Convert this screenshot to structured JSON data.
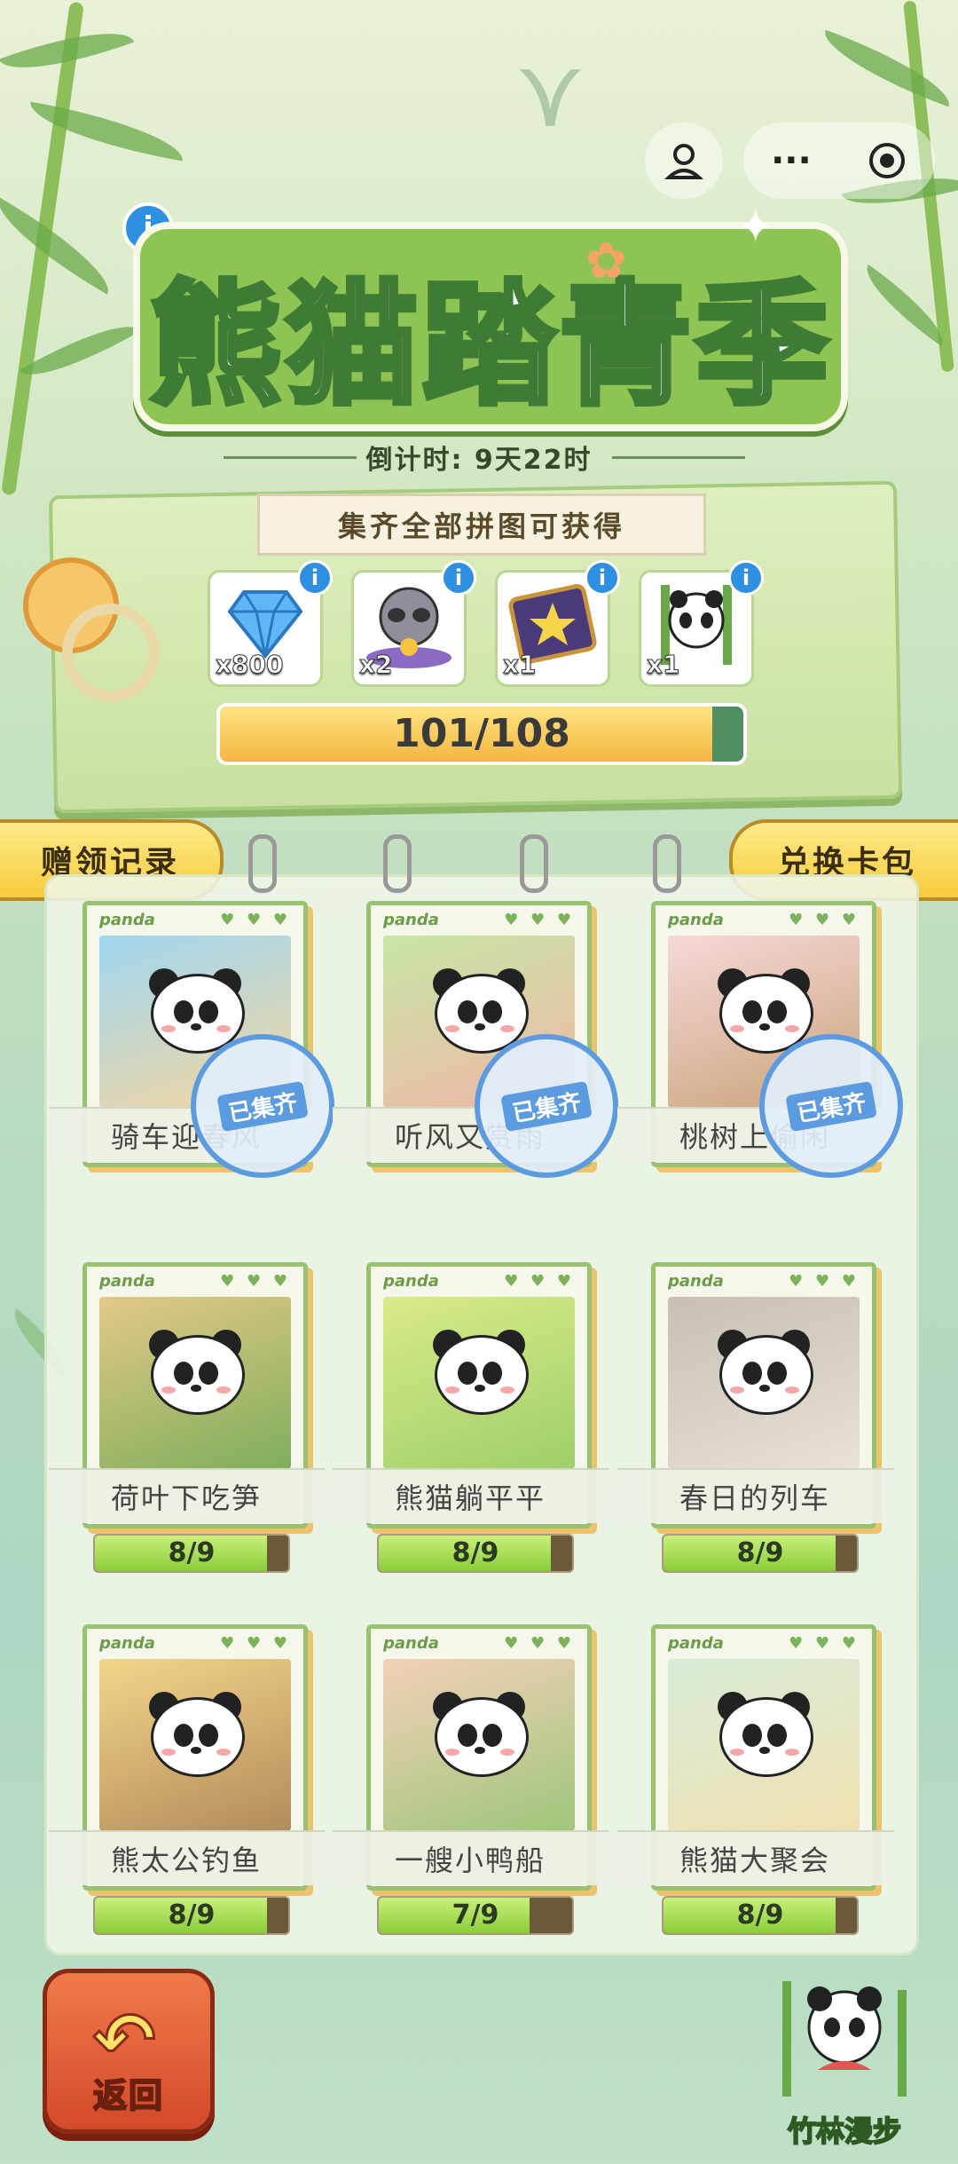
{
  "header": {
    "title": "熊猫踏青季",
    "countdown": "倒计时: 9天22时"
  },
  "rewards": {
    "ribbon_text": "集齐全部拼图可获得",
    "items": [
      {
        "icon": "diamond-icon",
        "qty": "x800"
      },
      {
        "icon": "raccoon-gift-icon",
        "qty": "x2"
      },
      {
        "icon": "star-card-icon",
        "qty": "x1"
      },
      {
        "icon": "bamboo-panda-icon",
        "qty": "x1"
      }
    ],
    "progress_text": "101/108",
    "progress_value": 0.935
  },
  "tabs": {
    "left": "赠领记录",
    "right": "兑换卡包"
  },
  "cards": [
    {
      "name": "骑车迎春风",
      "collected": true,
      "stamp": "已集齐",
      "progress": "",
      "progress_value": 1
    },
    {
      "name": "听风又赏雨",
      "collected": true,
      "stamp": "已集齐",
      "progress": "",
      "progress_value": 1
    },
    {
      "name": "桃树上偷闲",
      "collected": true,
      "stamp": "已集齐",
      "progress": "",
      "progress_value": 1
    },
    {
      "name": "荷叶下吃笋",
      "collected": false,
      "stamp": "",
      "progress": "8/9",
      "progress_value": 0.889
    },
    {
      "name": "熊猫躺平平",
      "collected": false,
      "stamp": "",
      "progress": "8/9",
      "progress_value": 0.889
    },
    {
      "name": "春日的列车",
      "collected": false,
      "stamp": "",
      "progress": "8/9",
      "progress_value": 0.889
    },
    {
      "name": "熊太公钓鱼",
      "collected": false,
      "stamp": "",
      "progress": "8/9",
      "progress_value": 0.889
    },
    {
      "name": "一艘小鸭船",
      "collected": false,
      "stamp": "",
      "progress": "7/9",
      "progress_value": 0.778
    },
    {
      "name": "熊猫大聚会",
      "collected": false,
      "stamp": "",
      "progress": "8/9",
      "progress_value": 0.889
    }
  ],
  "card_brand": "panda",
  "card_hearts": "♥ ♥ ♥",
  "footer": {
    "back_label": "返回",
    "bamboo_label": "竹林漫步"
  },
  "capsule": {
    "menu_dots": "···"
  },
  "colors": {
    "accent_green": "#8ec454",
    "tab_yellow": "#f5cc3a",
    "back_red": "#d24a2a",
    "stamp_blue": "#5d9be0"
  }
}
